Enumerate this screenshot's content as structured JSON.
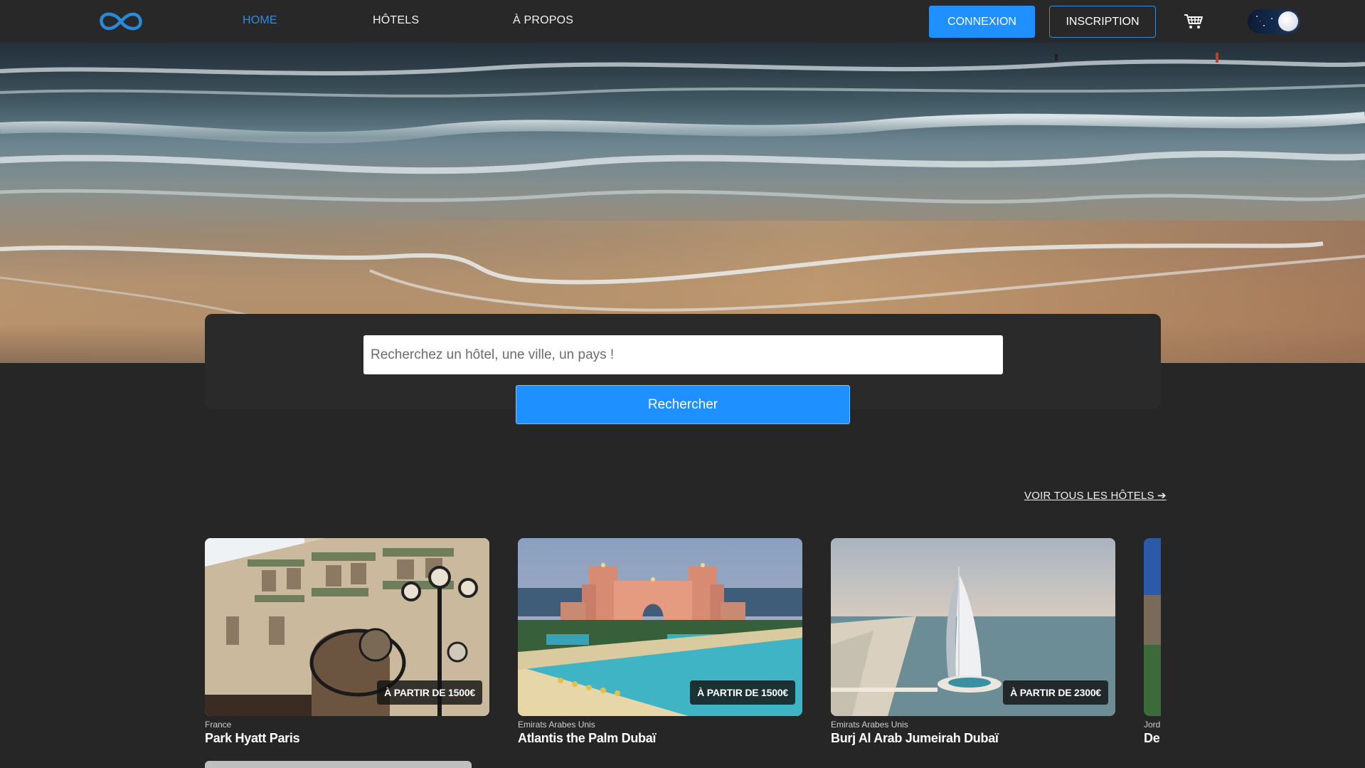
{
  "nav": {
    "links": [
      {
        "label": "HOME",
        "active": true
      },
      {
        "label": "HÔTELS",
        "active": false
      },
      {
        "label": "À PROPOS",
        "active": false
      }
    ],
    "login_label": "CONNEXION",
    "register_label": "INSCRIPTION",
    "cart_icon": "cart-icon",
    "theme_toggle_icon": "moon-icon"
  },
  "search": {
    "placeholder": "Recherchez un hôtel, une ville, un pays !",
    "button_label": "Rechercher"
  },
  "see_all_label": "VOIR TOUS LES HÔTELS ➔",
  "hotels": [
    {
      "country": "France",
      "name": "Park Hyatt Paris",
      "price": "À PARTIR DE 1500€"
    },
    {
      "country": "Emirats Arabes Unis",
      "name": "Atlantis the Palm Dubaï",
      "price": "À PARTIR DE 1500€"
    },
    {
      "country": "Emirats Arabes Unis",
      "name": "Burj Al Arab Jumeirah Dubaï",
      "price": "À PARTIR DE 2300€"
    },
    {
      "country": "Jord",
      "name": "De",
      "price": ""
    }
  ],
  "colors": {
    "accent": "#1e90ff",
    "background": "#262626",
    "navbar": "#282828"
  }
}
